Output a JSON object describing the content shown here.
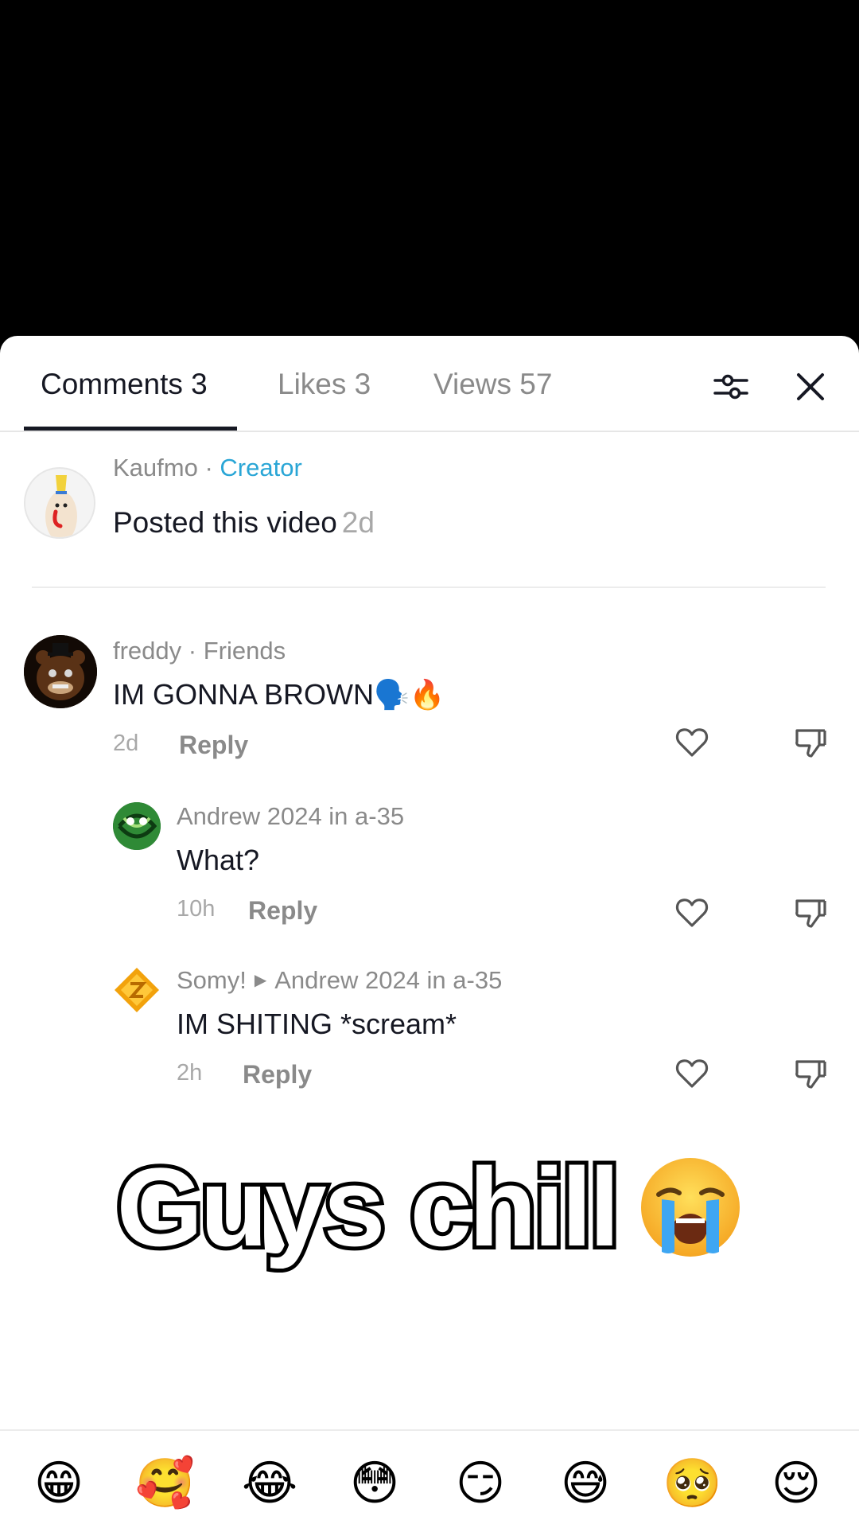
{
  "tabs": {
    "comments": "Comments 3",
    "likes": "Likes 3",
    "views": "Views 57"
  },
  "post": {
    "author": "Kaufmo",
    "separator": " · ",
    "tag": "Creator",
    "text": "Posted this video",
    "time": "2d"
  },
  "comments": [
    {
      "author": "freddy",
      "tag": " · Friends",
      "text": "IM GONNA BROWN🗣️🔥",
      "time": "2d",
      "reply_label": "Reply"
    },
    {
      "author": "Andrew 2024 in a-35",
      "text": "What?",
      "time": "10h",
      "reply_label": "Reply"
    },
    {
      "author": "Somy!",
      "reply_to": "Andrew 2024 in a-35",
      "text": "IM SHITING *scream*",
      "time": "2h",
      "reply_label": "Reply"
    }
  ],
  "caption": {
    "text": "Guys chill",
    "emoji": "loudly-crying-face"
  },
  "emoji_bar": [
    "😁",
    "🥰",
    "😂",
    "😳",
    "😏",
    "😅",
    "🥺",
    "😌"
  ],
  "colors": {
    "creator_tag": "#2aa6d6",
    "text_primary": "#161823",
    "text_secondary": "#8a8a8a"
  }
}
